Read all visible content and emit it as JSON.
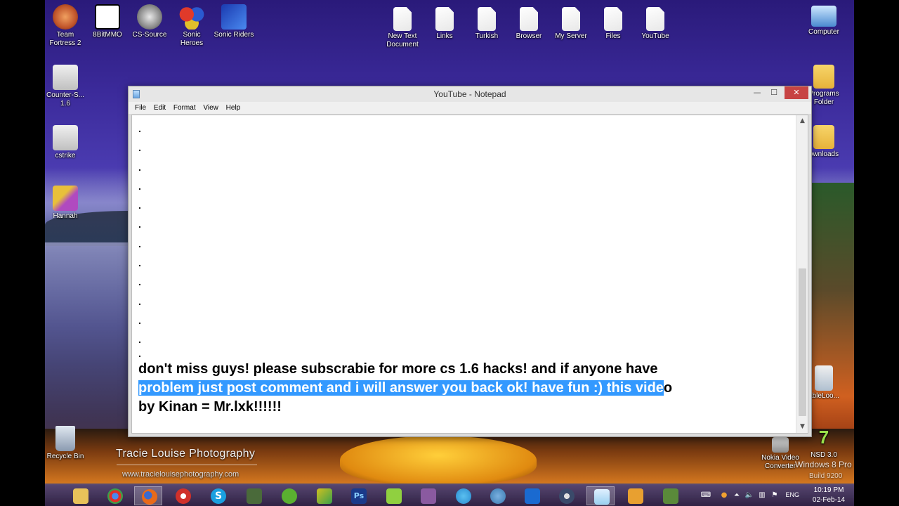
{
  "desktop": {
    "icons_top": [
      {
        "label": "Team Fortress 2",
        "icon": "tf2-icon",
        "color": "#c0542a"
      },
      {
        "label": "8BitMMO",
        "icon": "8bitmmo-icon",
        "color": "#ffffff"
      },
      {
        "label": "CS-Source",
        "icon": "cs-source-icon",
        "color": "#8a8a8a"
      },
      {
        "label": "Sonic Heroes",
        "icon": "sonic-heroes-icon",
        "color": "#d03a2a"
      },
      {
        "label": "Sonic Riders",
        "icon": "sonic-riders-icon",
        "color": "#2a5ad0"
      }
    ],
    "files_top": [
      {
        "label": "New Text Document",
        "icon": "text-file-icon"
      },
      {
        "label": "Links",
        "icon": "text-file-icon"
      },
      {
        "label": "Turkish",
        "icon": "text-file-icon"
      },
      {
        "label": "Browser",
        "icon": "text-file-icon"
      },
      {
        "label": "My Server",
        "icon": "text-file-icon"
      },
      {
        "label": "Files",
        "icon": "text-file-icon"
      },
      {
        "label": "YouTube",
        "icon": "text-file-icon"
      }
    ],
    "icons_left": [
      {
        "label": "Counter-S... 1.6",
        "icon": "counter-strike-icon"
      },
      {
        "label": "cstrike",
        "icon": "cstrike-icon"
      },
      {
        "label": "Hannah",
        "icon": "hannah-icon"
      }
    ],
    "icons_right": [
      {
        "label": "Computer",
        "icon": "computer-icon"
      },
      {
        "label": "Programs Folder",
        "icon": "folder-icon"
      },
      {
        "label": "ownloads",
        "icon": "downloads-folder-icon"
      },
      {
        "label": "ableLoo...",
        "icon": "portable-icon"
      },
      {
        "label": "NSD 3.0",
        "icon": "nsd-icon"
      },
      {
        "label": "Nokia Video Converter",
        "icon": "nokia-video-icon"
      }
    ],
    "recycle_bin": {
      "label": "Recycle Bin",
      "icon": "recycle-bin-icon"
    },
    "watermark": {
      "title": "Tracie Louise Photography",
      "url": "www.tracielouisephotography.com"
    },
    "windows_version": "Windows 8 Pro",
    "windows_build": "Build 9200"
  },
  "notepad": {
    "title": "YouTube - Notepad",
    "menu": [
      "File",
      "Edit",
      "Format",
      "View",
      "Help"
    ],
    "dot_lines": [
      ".",
      ".",
      ".",
      ".",
      ".",
      ".",
      ".",
      ".",
      ".",
      ".",
      ".",
      ".",
      "."
    ],
    "line1": "don't miss guys! please subscrabie for more cs 1.6 hacks! and if anyone have",
    "line2_selected": "problem just post comment and i will answer you back ok! have fun :) this vide",
    "line2_rest": "o",
    "line3": "by Kinan = Mr.lxk!!!!!!"
  },
  "taskbar": {
    "apps": [
      {
        "name": "file-explorer",
        "color": "#e8c25a"
      },
      {
        "name": "chrome",
        "color": "#3aa04a"
      },
      {
        "name": "firefox",
        "color": "#e86a1a"
      },
      {
        "name": "opera",
        "color": "#d0302a"
      },
      {
        "name": "skype",
        "color": "#1aa0e0"
      },
      {
        "name": "cmd-tool",
        "color": "#4a6a3a"
      },
      {
        "name": "utorrent",
        "color": "#5ab030"
      },
      {
        "name": "app-green",
        "color": "#d0c020"
      },
      {
        "name": "photoshop",
        "color": "#1a3a8a"
      },
      {
        "name": "app-android",
        "color": "#90d040"
      },
      {
        "name": "winrar",
        "color": "#8a5aa0"
      },
      {
        "name": "app-globe",
        "color": "#2a8ad0"
      },
      {
        "name": "app-globe-2",
        "color": "#3a7ab0"
      },
      {
        "name": "app-blue",
        "color": "#1a6ad0"
      },
      {
        "name": "steam",
        "color": "#3a4a6a"
      },
      {
        "name": "notepad",
        "color": "#9ad0f0"
      },
      {
        "name": "media-player",
        "color": "#e8a030"
      },
      {
        "name": "app-last",
        "color": "#5a8a3a"
      }
    ],
    "tray": {
      "lang": "ENG",
      "time": "10:19 PM",
      "date": "02-Feb-14"
    }
  }
}
